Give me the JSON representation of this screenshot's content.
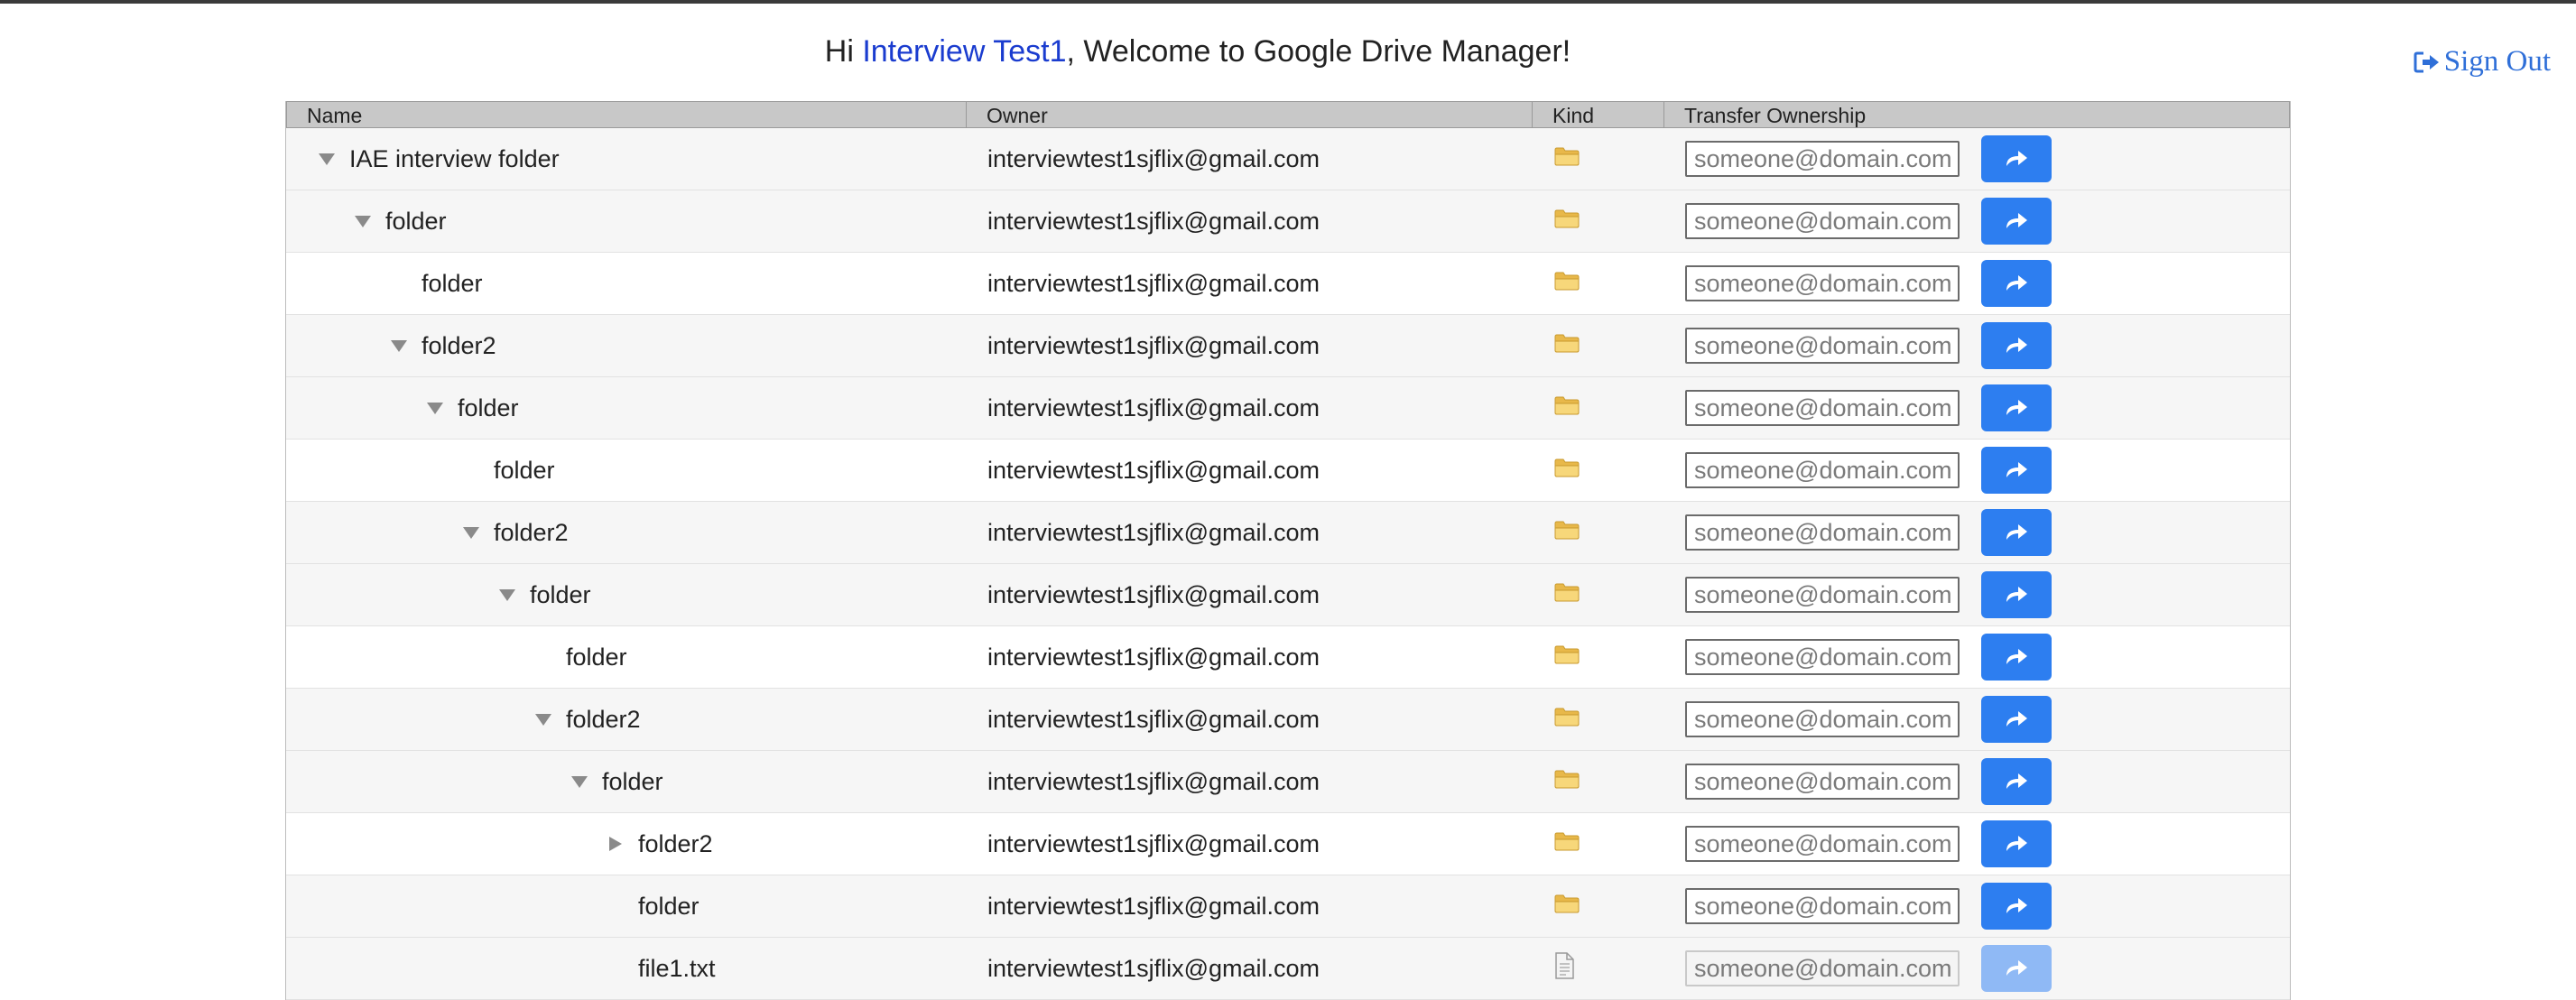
{
  "header": {
    "greeting_prefix": "Hi ",
    "user_name": "Interview Test1",
    "greeting_suffix": ", Welcome to Google Drive Manager!",
    "sign_out_label": "Sign Out"
  },
  "table": {
    "columns": [
      "Name",
      "Owner",
      "Kind",
      "Transfer Ownership"
    ],
    "email_placeholder": "someone@domain.com",
    "rows": [
      {
        "name": "IAE interview folder",
        "owner": "interviewtest1sjflix@gmail.com",
        "kind": "folder",
        "depth": 0,
        "toggle": "expanded",
        "enabled": true
      },
      {
        "name": "folder",
        "owner": "interviewtest1sjflix@gmail.com",
        "kind": "folder",
        "depth": 1,
        "toggle": "expanded",
        "enabled": true
      },
      {
        "name": "folder",
        "owner": "interviewtest1sjflix@gmail.com",
        "kind": "folder",
        "depth": 2,
        "toggle": "none",
        "enabled": true
      },
      {
        "name": "folder2",
        "owner": "interviewtest1sjflix@gmail.com",
        "kind": "folder",
        "depth": 2,
        "toggle": "expanded",
        "enabled": true
      },
      {
        "name": "folder",
        "owner": "interviewtest1sjflix@gmail.com",
        "kind": "folder",
        "depth": 3,
        "toggle": "expanded",
        "enabled": true
      },
      {
        "name": "folder",
        "owner": "interviewtest1sjflix@gmail.com",
        "kind": "folder",
        "depth": 4,
        "toggle": "none",
        "enabled": true
      },
      {
        "name": "folder2",
        "owner": "interviewtest1sjflix@gmail.com",
        "kind": "folder",
        "depth": 4,
        "toggle": "expanded",
        "enabled": true
      },
      {
        "name": "folder",
        "owner": "interviewtest1sjflix@gmail.com",
        "kind": "folder",
        "depth": 5,
        "toggle": "expanded",
        "enabled": true
      },
      {
        "name": "folder",
        "owner": "interviewtest1sjflix@gmail.com",
        "kind": "folder",
        "depth": 6,
        "toggle": "none",
        "enabled": true
      },
      {
        "name": "folder2",
        "owner": "interviewtest1sjflix@gmail.com",
        "kind": "folder",
        "depth": 6,
        "toggle": "expanded",
        "enabled": true
      },
      {
        "name": "folder",
        "owner": "interviewtest1sjflix@gmail.com",
        "kind": "folder",
        "depth": 7,
        "toggle": "expanded",
        "enabled": true
      },
      {
        "name": "folder2",
        "owner": "interviewtest1sjflix@gmail.com",
        "kind": "folder",
        "depth": 8,
        "toggle": "collapsed",
        "enabled": true
      },
      {
        "name": "folder",
        "owner": "interviewtest1sjflix@gmail.com",
        "kind": "folder",
        "depth": 8,
        "toggle": "none",
        "enabled": true
      },
      {
        "name": "file1.txt",
        "owner": "interviewtest1sjflix@gmail.com",
        "kind": "file",
        "depth": 8,
        "toggle": "none",
        "enabled": false
      }
    ]
  },
  "colors": {
    "accent": "#2d7ef0",
    "accent_disabled": "#8fb9f5",
    "user_name": "#1a3ccf",
    "sign_out": "#2f6fd8",
    "folder_icon": "#f2c65b"
  },
  "icons": {
    "sign_out": "sign-out-icon",
    "expanded": "triangle-down-icon",
    "collapsed": "triangle-right-icon",
    "folder": "folder-icon",
    "file": "file-icon",
    "transfer": "share-arrow-icon"
  }
}
